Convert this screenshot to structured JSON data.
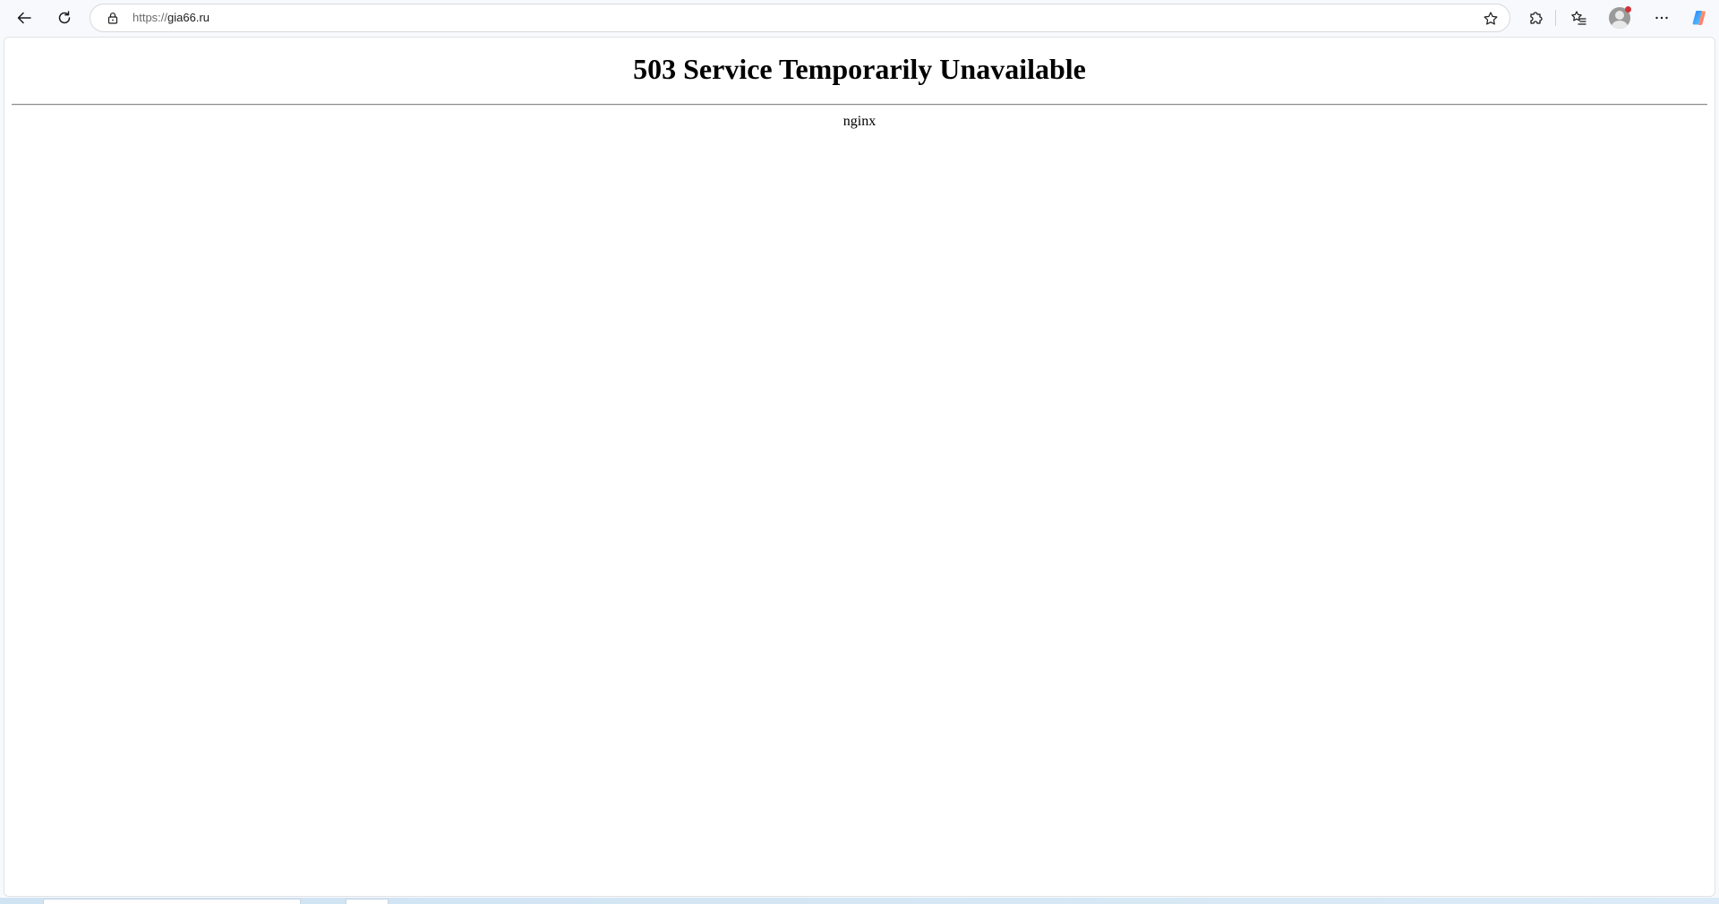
{
  "browser": {
    "url_scheme": "https://",
    "url_host": "gia66.ru",
    "icons": {
      "back": "arrow-left-icon",
      "reload": "reload-icon",
      "lock": "lock-icon",
      "favorite": "star-icon",
      "extensions": "puzzle-icon",
      "favorites": "favorites-list-icon",
      "profile": "avatar-icon",
      "more": "ellipsis-icon",
      "copilot": "copilot-icon"
    },
    "colors": {
      "notification_dot": "#d13438"
    }
  },
  "page": {
    "title": "503 Service Temporarily Unavailable",
    "server": "nginx"
  }
}
